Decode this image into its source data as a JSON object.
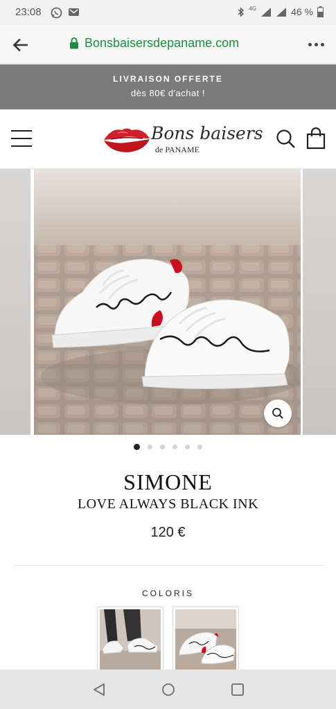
{
  "status_bar": {
    "time": "23:08",
    "network": "4G",
    "battery": "46 %"
  },
  "browser": {
    "url": "Bonsbaisersdepaname.com",
    "icons": [
      "back-arrow-icon",
      "lock-icon",
      "more-vert-icon"
    ]
  },
  "promo": {
    "line1": "LIVRAISON OFFERTE",
    "line2": "dès 80€ d'achat !"
  },
  "header": {
    "logo_script": "Bons baisers",
    "logo_sub": "de PANAME",
    "icons": [
      "menu-icon",
      "search-icon",
      "shopping-bag-icon"
    ]
  },
  "product": {
    "name": "SIMONE",
    "subtitle": "LOVE ALWAYS BLACK INK",
    "price": "120 €",
    "image_count": 6,
    "active_image": 1
  },
  "coloris": {
    "label": "COLORIS"
  },
  "colors": {
    "brand_red": "#d0202a",
    "url_green": "#1e8e3e",
    "promo_bg": "#7b7b7b"
  }
}
